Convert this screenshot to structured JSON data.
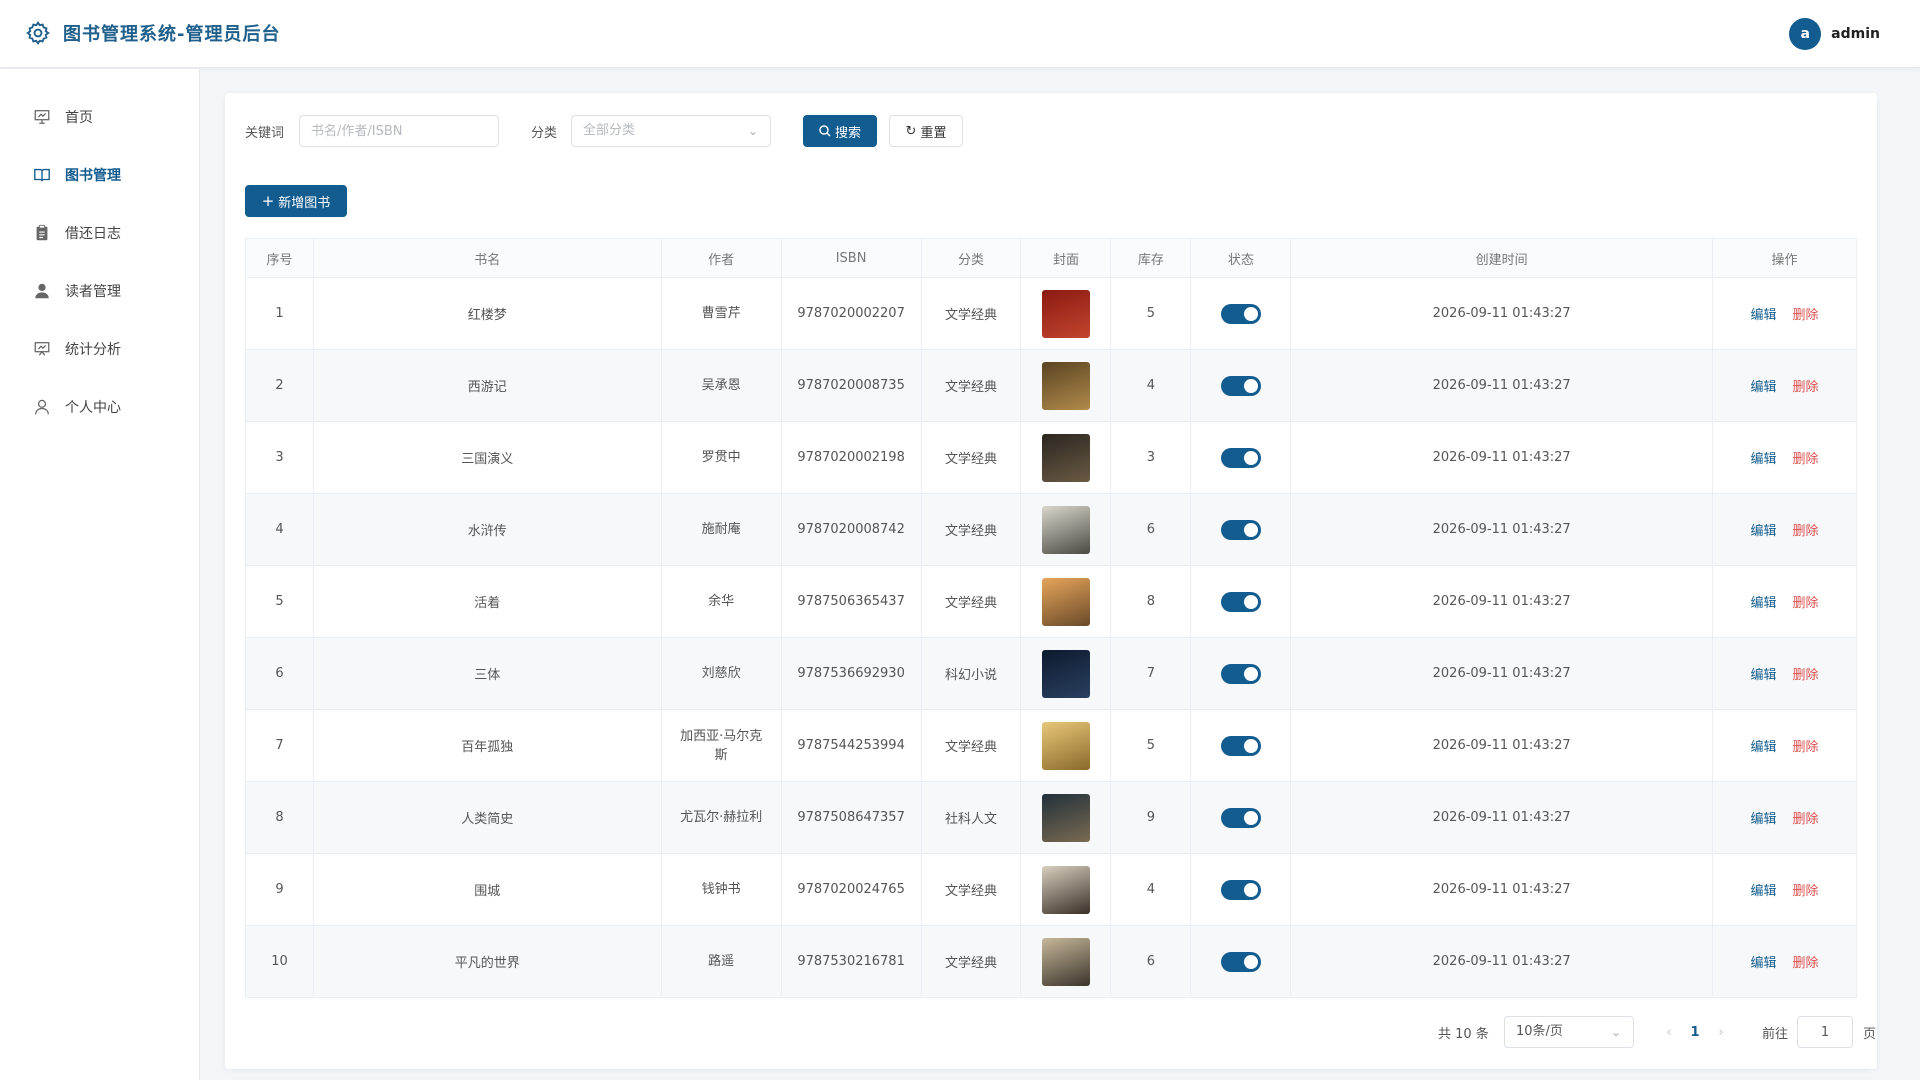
{
  "header": {
    "title": "图书管理系统-管理员后台",
    "avatar_letter": "a",
    "username": "admin"
  },
  "sidebar": {
    "items": [
      {
        "label": "首页",
        "icon": "presentation-icon"
      },
      {
        "label": "图书管理",
        "icon": "book-open-icon",
        "active": true
      },
      {
        "label": "借还日志",
        "icon": "clipboard-icon"
      },
      {
        "label": "读者管理",
        "icon": "user-filled-icon"
      },
      {
        "label": "统计分析",
        "icon": "chart-board-icon"
      },
      {
        "label": "个人中心",
        "icon": "user-outline-icon"
      }
    ]
  },
  "search": {
    "keyword_label": "关键词",
    "keyword_placeholder": "书名/作者/ISBN",
    "category_label": "分类",
    "category_placeholder": "全部分类",
    "search_button": "搜索",
    "reset_button": "重置"
  },
  "toolbar": {
    "add_button": "新增图书"
  },
  "table": {
    "columns": [
      "序号",
      "书名",
      "作者",
      "ISBN",
      "分类",
      "封面",
      "库存",
      "状态",
      "创建时间",
      "操作"
    ],
    "edit_label": "编辑",
    "delete_label": "删除",
    "rows": [
      {
        "no": "1",
        "title": "红楼梦",
        "author": "曹雪芹",
        "isbn": "9787020002207",
        "category": "文学经典",
        "stock": "5",
        "created": "2026-09-11 01:43:27",
        "cover_colors": [
          "#8a1a12",
          "#c2452e"
        ],
        "enabled": true
      },
      {
        "no": "2",
        "title": "西游记",
        "author": "吴承恩",
        "isbn": "9787020008735",
        "category": "文学经典",
        "stock": "4",
        "created": "2026-09-11 01:43:27",
        "cover_colors": [
          "#5a4422",
          "#b18a4b"
        ],
        "enabled": true
      },
      {
        "no": "3",
        "title": "三国演义",
        "author": "罗贯中",
        "isbn": "9787020002198",
        "category": "文学经典",
        "stock": "3",
        "created": "2026-09-11 01:43:27",
        "cover_colors": [
          "#2a2620",
          "#6a5a44"
        ],
        "enabled": true
      },
      {
        "no": "4",
        "title": "水浒传",
        "author": "施耐庵",
        "isbn": "9787020008742",
        "category": "文学经典",
        "stock": "6",
        "created": "2026-09-11 01:43:27",
        "cover_colors": [
          "#d9d6cc",
          "#4a4a42"
        ],
        "enabled": true
      },
      {
        "no": "5",
        "title": "活着",
        "author": "余华",
        "isbn": "9787506365437",
        "category": "文学经典",
        "stock": "8",
        "created": "2026-09-11 01:43:27",
        "cover_colors": [
          "#e6a55a",
          "#6a4a2a"
        ],
        "enabled": true
      },
      {
        "no": "6",
        "title": "三体",
        "author": "刘慈欣",
        "isbn": "9787536692930",
        "category": "科幻小说",
        "stock": "7",
        "created": "2026-09-11 01:43:27",
        "cover_colors": [
          "#0d1a2e",
          "#2a4060"
        ],
        "enabled": true
      },
      {
        "no": "7",
        "title": "百年孤独",
        "author": "加西亚·马尔克斯",
        "isbn": "9787544253994",
        "category": "文学经典",
        "stock": "5",
        "created": "2026-09-11 01:43:27",
        "cover_colors": [
          "#e8c77a",
          "#8a6a2a"
        ],
        "enabled": true
      },
      {
        "no": "8",
        "title": "人类简史",
        "author": "尤瓦尔·赫拉利",
        "isbn": "9787508647357",
        "category": "社科人文",
        "stock": "9",
        "created": "2026-09-11 01:43:27",
        "cover_colors": [
          "#22303a",
          "#7a6a52"
        ],
        "enabled": true
      },
      {
        "no": "9",
        "title": "围城",
        "author": "钱钟书",
        "isbn": "9787020024765",
        "category": "文学经典",
        "stock": "4",
        "created": "2026-09-11 01:43:27",
        "cover_colors": [
          "#d8cfbf",
          "#3a3028"
        ],
        "enabled": true
      },
      {
        "no": "10",
        "title": "平凡的世界",
        "author": "路遥",
        "isbn": "9787530216781",
        "category": "文学经典",
        "stock": "6",
        "created": "2026-09-11 01:43:27",
        "cover_colors": [
          "#c8b89a",
          "#3a342c"
        ],
        "enabled": true
      }
    ]
  },
  "pagination": {
    "total_text": "共 10 条",
    "page_size": "10条/页",
    "current_page": "1",
    "goto_label": "前往",
    "goto_value": "1",
    "page_suffix": "页"
  },
  "colors": {
    "primary": "#125c8f",
    "danger": "#e0504c"
  }
}
